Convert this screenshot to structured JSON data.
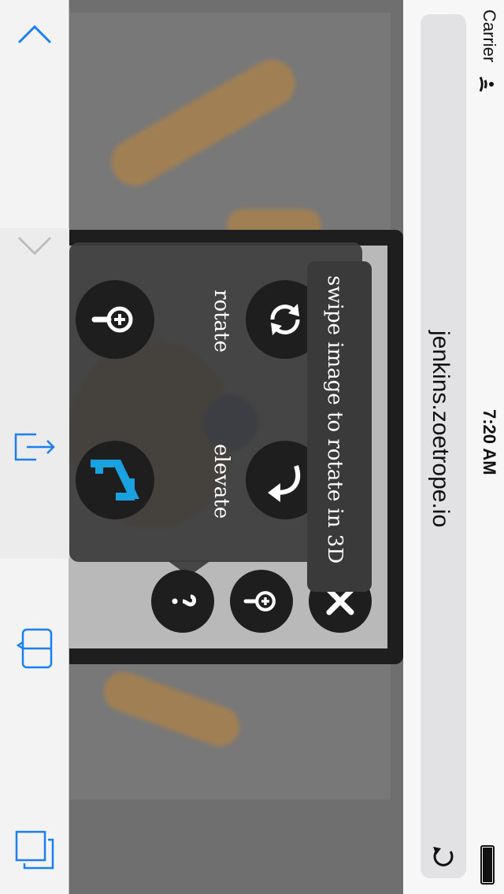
{
  "browser": {
    "url": "jenkins.zoetrope.io",
    "status": {
      "carrier": "Carrier",
      "time": "7:20 AM"
    },
    "toolbar": {
      "up_icon": "chevron-up-icon",
      "down_icon": "chevron-down-icon",
      "share_icon": "share-icon",
      "bookmarks_icon": "book-icon",
      "tabs_icon": "tabs-icon"
    },
    "reload_icon": "reload-icon"
  },
  "viewer": {
    "tooltip": "swipe image to rotate in 3D",
    "help": {
      "rotate_label": "rotate",
      "elevate_label": "elevate"
    },
    "controls": {
      "help_icon": "question-icon",
      "zoom_icon": "zoom-in-icon",
      "close_icon": "close-icon"
    },
    "colors": {
      "accent": "#1aa1e0",
      "button": "#1e1e1e"
    }
  }
}
